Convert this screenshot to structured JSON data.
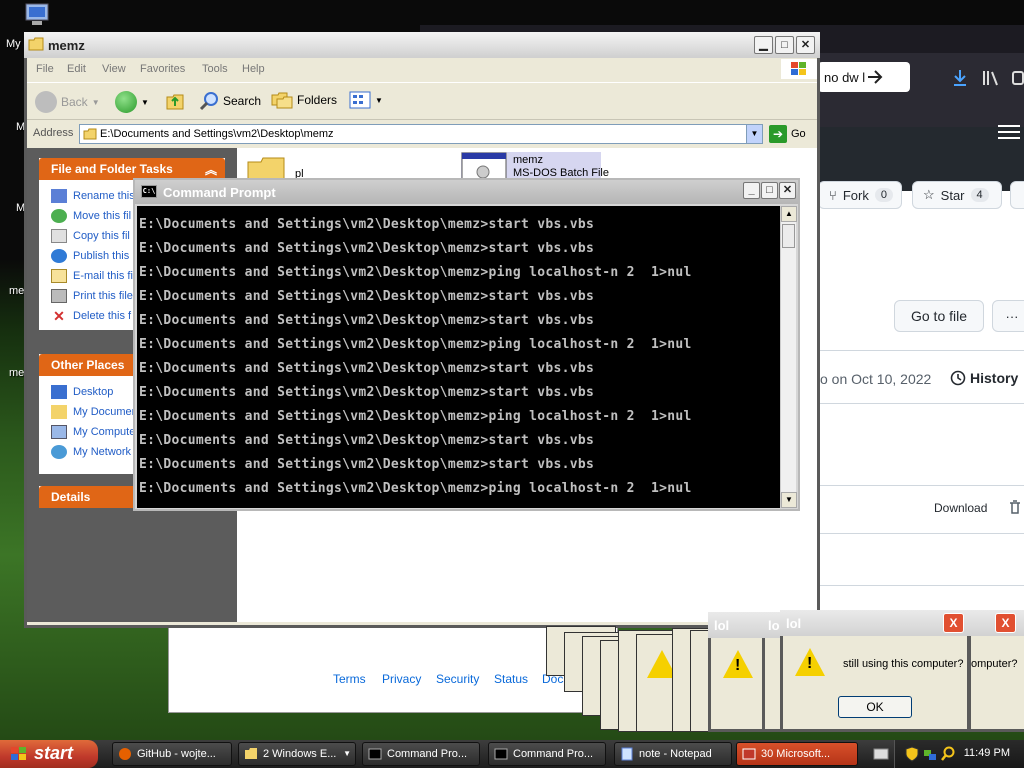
{
  "desktop": {
    "icon_labels": [
      "My",
      "M",
      "M",
      "me",
      "me"
    ]
  },
  "firefox": {
    "url_fragment": "no dw l",
    "hamburger_label": "",
    "fork_label": "Fork",
    "fork_count": "0",
    "star_label": "Star",
    "star_count": "4",
    "go_to_file": "Go to file",
    "more_label": "···",
    "commit_date": "o on Oct 10, 2022",
    "history_label": "History",
    "download_label": "Download",
    "footer_links": [
      "Terms",
      "Privacy",
      "Security",
      "Status",
      "Docs"
    ]
  },
  "explorer": {
    "title": "memz",
    "menu": [
      "File",
      "Edit",
      "View",
      "Favorites",
      "Tools",
      "Help"
    ],
    "toolbar": {
      "back": "Back",
      "search": "Search",
      "folders": "Folders"
    },
    "address_label": "Address",
    "address_value": "E:\\Documents and Settings\\vm2\\Desktop\\memz",
    "go_label": "Go",
    "file_tasks_title": "File and Folder Tasks",
    "file_tasks": [
      "Rename this",
      "Move this fil",
      "Copy this fil",
      "Publish this",
      "E-mail this fi",
      "Print this file",
      "Delete this f"
    ],
    "other_places_title": "Other Places",
    "other_places": [
      "Desktop",
      "My Documer",
      "My Compute",
      "My Network"
    ],
    "details_title": "Details",
    "file_item_name": "memz",
    "file_item_type": "MS-DOS Batch File",
    "folder_item_name": "pl"
  },
  "cmd": {
    "title": "Command Prompt",
    "icon_text": "C:\\",
    "lines": [
      "E:\\Documents and Settings\\vm2\\Desktop\\memz>start vbs.vbs",
      "E:\\Documents and Settings\\vm2\\Desktop\\memz>start vbs.vbs",
      "E:\\Documents and Settings\\vm2\\Desktop\\memz>ping localhost-n 2  1>nul",
      "E:\\Documents and Settings\\vm2\\Desktop\\memz>start vbs.vbs",
      "E:\\Documents and Settings\\vm2\\Desktop\\memz>start vbs.vbs",
      "E:\\Documents and Settings\\vm2\\Desktop\\memz>ping localhost-n 2  1>nul",
      "E:\\Documents and Settings\\vm2\\Desktop\\memz>start vbs.vbs",
      "E:\\Documents and Settings\\vm2\\Desktop\\memz>start vbs.vbs",
      "E:\\Documents and Settings\\vm2\\Desktop\\memz>ping localhost-n 2  1>nul",
      "E:\\Documents and Settings\\vm2\\Desktop\\memz>start vbs.vbs",
      "E:\\Documents and Settings\\vm2\\Desktop\\memz>start vbs.vbs",
      "E:\\Documents and Settings\\vm2\\Desktop\\memz>ping localhost-n 2  1>nul"
    ]
  },
  "msgbox": {
    "title_main": "lol",
    "title_left": "lol",
    "title_partial": "lo",
    "message": "still using this computer?",
    "message_partial": "omputer?",
    "ok_label": "OK",
    "close_label": "X"
  },
  "taskbar": {
    "start_label": "start",
    "buttons": [
      "GitHub - wojte...",
      "2 Windows E...",
      "Command Pro...",
      "Command Pro...",
      "note - Notepad",
      "30 Microsoft..."
    ],
    "clock": "11:49 PM"
  },
  "colors": {
    "xp_orange": "#e06616",
    "cmd_text": "#c0c0c0",
    "link_blue": "#0969da",
    "close_red": "#e15031",
    "warning_yellow": "#f5d000"
  }
}
